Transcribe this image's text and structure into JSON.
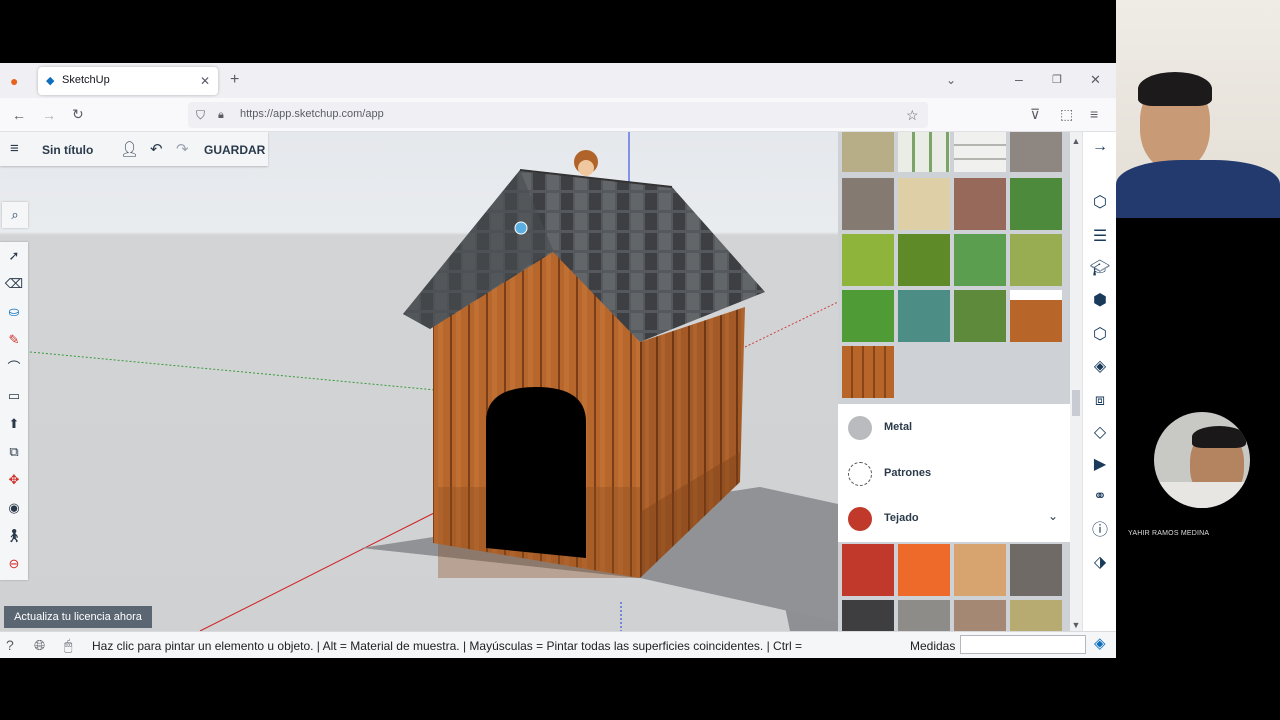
{
  "browser": {
    "tab_title": "SketchUp",
    "url": "https://app.sketchup.com/app"
  },
  "app": {
    "doc_title": "Sin título",
    "save_label": "GUARDAR",
    "license_button": "Actualiza tu licencia ahora"
  },
  "materials": {
    "categories": [
      {
        "label": "Metal",
        "color": "#b9bbbe"
      },
      {
        "label": "Patrones",
        "color": "#ffffff"
      },
      {
        "label": "Tejado",
        "color": "#c0392b"
      }
    ]
  },
  "status": {
    "hint": "Haz clic para pintar un elemento u objeto. | Alt = Material de muestra. | Mayúsculas = Pintar todas las superficies coincidentes. | Ctrl =",
    "measures_label": "Medidas",
    "measures_value": ""
  },
  "webcam": {
    "name": "YAHIR  RAMOS MEDINA"
  },
  "colors": {
    "accent": "#0e6fbe",
    "wood": "#b5692e",
    "roof": "#4b4d50"
  }
}
